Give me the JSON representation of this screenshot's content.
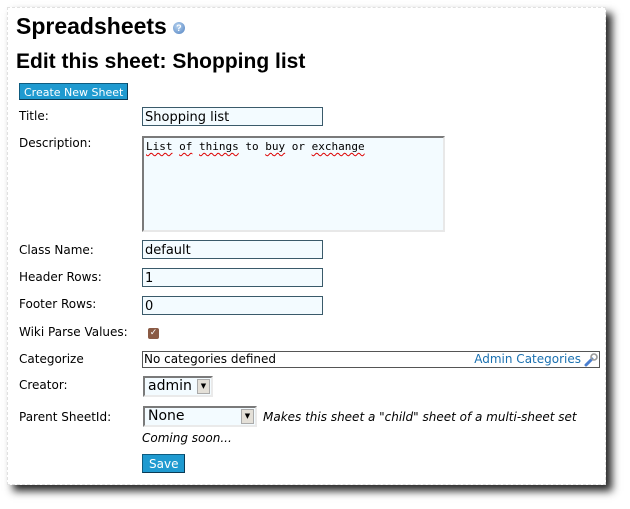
{
  "header": {
    "app_title": "Spreadsheets",
    "help_icon": "help-icon",
    "page_title": "Edit this sheet: Shopping list"
  },
  "toolbar": {
    "create_label": "Create New Sheet"
  },
  "form": {
    "title": {
      "label": "Title:",
      "value": "Shopping list"
    },
    "description": {
      "label": "Description:",
      "value": "List of things to buy or exchange",
      "misspelled_words": [
        "List",
        "of",
        "things",
        "buy",
        "exchange"
      ]
    },
    "class_name": {
      "label": "Class Name:",
      "value": "default"
    },
    "header_rows": {
      "label": "Header Rows:",
      "value": "1"
    },
    "footer_rows": {
      "label": "Footer Rows:",
      "value": "0"
    },
    "wiki_parse": {
      "label": "Wiki Parse Values:",
      "checked": true
    },
    "categorize": {
      "label": "Categorize",
      "empty_text": "No categories defined",
      "admin_link": "Admin Categories",
      "icon": "wrench-icon"
    },
    "creator": {
      "label": "Creator:",
      "selected": "admin"
    },
    "parent": {
      "label": "Parent SheetId:",
      "selected": "None",
      "hint": "Makes this sheet a \"child\" sheet of a multi-sheet set",
      "coming_soon": "Coming soon..."
    },
    "save_label": "Save"
  },
  "colors": {
    "button_bg": "#1f9ad0",
    "input_bg": "#f3fbff",
    "link": "#1a70b0",
    "checkbox": "#8a5a44"
  }
}
